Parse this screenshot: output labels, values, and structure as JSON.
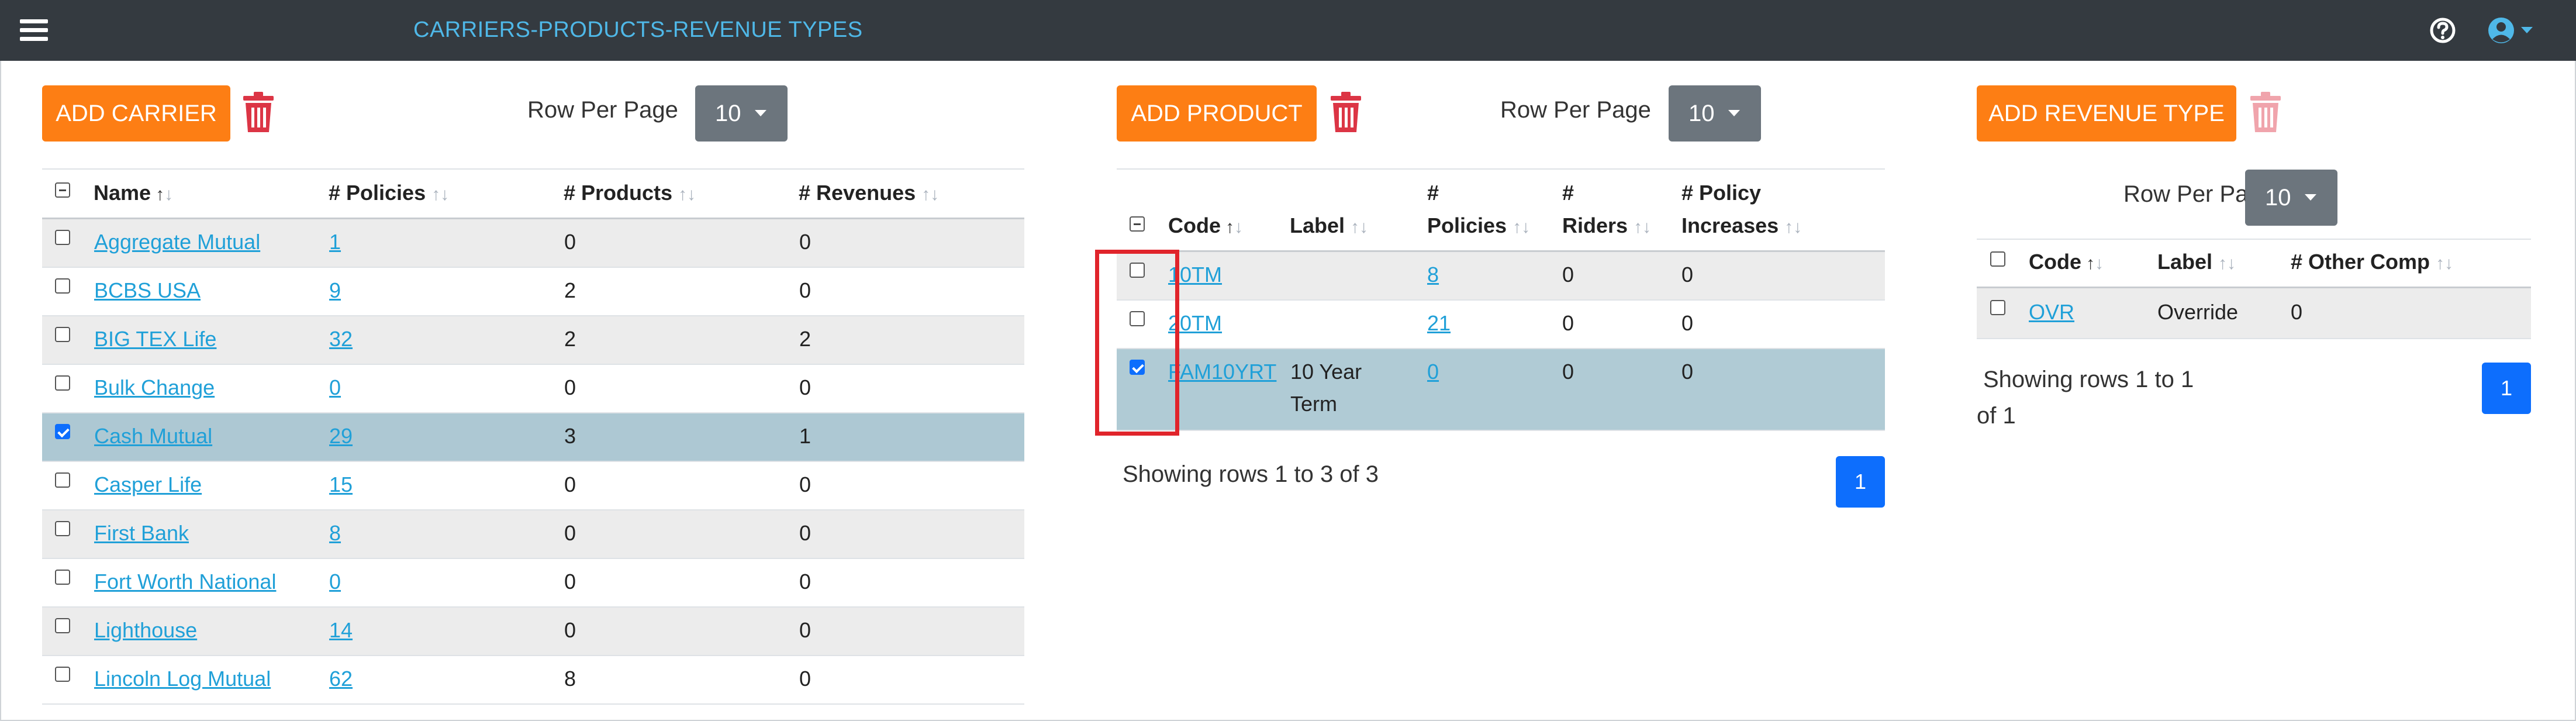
{
  "header": {
    "title": "CARRIERS-PRODUCTS-REVENUE TYPES",
    "menu_icon": "hamburger-icon",
    "help_icon": "question-circle-icon",
    "user_icon": "user-circle-icon"
  },
  "colors": {
    "topbar": "#343a40",
    "accent": "#fd7e14",
    "title": "#4fb8e8",
    "primary": "#0d6efd",
    "danger": "#dc3545",
    "selected_row": "#adc8d3"
  },
  "carriers": {
    "add_label": "ADD CARRIER",
    "rpp_label": "Row Per Page",
    "rpp_value": "10",
    "columns": [
      "Name",
      "# Policies",
      "# Products",
      "# Revenues"
    ],
    "rows": [
      {
        "name": "Aggregate Mutual",
        "policies": "1",
        "products": "0",
        "revenues": "0"
      },
      {
        "name": "BCBS USA",
        "policies": "9",
        "products": "2",
        "revenues": "0"
      },
      {
        "name": "BIG TEX Life",
        "policies": "32",
        "products": "2",
        "revenues": "2"
      },
      {
        "name": "Bulk Change",
        "policies": "0",
        "products": "0",
        "revenues": "0"
      },
      {
        "name": "Cash Mutual",
        "policies": "29",
        "products": "3",
        "revenues": "1"
      },
      {
        "name": "Casper Life",
        "policies": "15",
        "products": "0",
        "revenues": "0"
      },
      {
        "name": "First Bank",
        "policies": "8",
        "products": "0",
        "revenues": "0"
      },
      {
        "name": "Fort Worth National",
        "policies": "0",
        "products": "0",
        "revenues": "0"
      },
      {
        "name": "Lighthouse",
        "policies": "14",
        "products": "0",
        "revenues": "0"
      },
      {
        "name": "Lincoln Log Mutual",
        "policies": "62",
        "products": "8",
        "revenues": "0"
      }
    ]
  },
  "products": {
    "add_label": "ADD PRODUCT",
    "rpp_label": "Row Per Page",
    "rpp_value": "10",
    "columns": {
      "code": "Code",
      "label": "Label",
      "policies_1": "#",
      "policies_2": "Policies",
      "riders_1": "#",
      "riders_2": "Riders",
      "increases_1": "# Policy",
      "increases_2": "Increases"
    },
    "rows": [
      {
        "code": "10TM",
        "label": "",
        "policies": "8",
        "riders": "0",
        "increases": "0"
      },
      {
        "code": "20TM",
        "label": "",
        "policies": "21",
        "riders": "0",
        "increases": "0"
      },
      {
        "code": "FAM10YRT",
        "label_1": "10 Year",
        "label_2": "Term",
        "policies": "0",
        "riders": "0",
        "increases": "0"
      }
    ],
    "showing": "Showing rows 1 to 3 of 3",
    "page": "1"
  },
  "revenue_types": {
    "add_label": "ADD REVENUE TYPE",
    "rpp_label": "Row Per Page",
    "rpp_value": "10",
    "columns": [
      "Code",
      "Label",
      "# Other Comp"
    ],
    "rows": [
      {
        "code": "OVR",
        "label": "Override",
        "other_comp": "0"
      }
    ],
    "showing_1": "Showing rows 1 to 1",
    "showing_2": "of 1",
    "page": "1"
  }
}
